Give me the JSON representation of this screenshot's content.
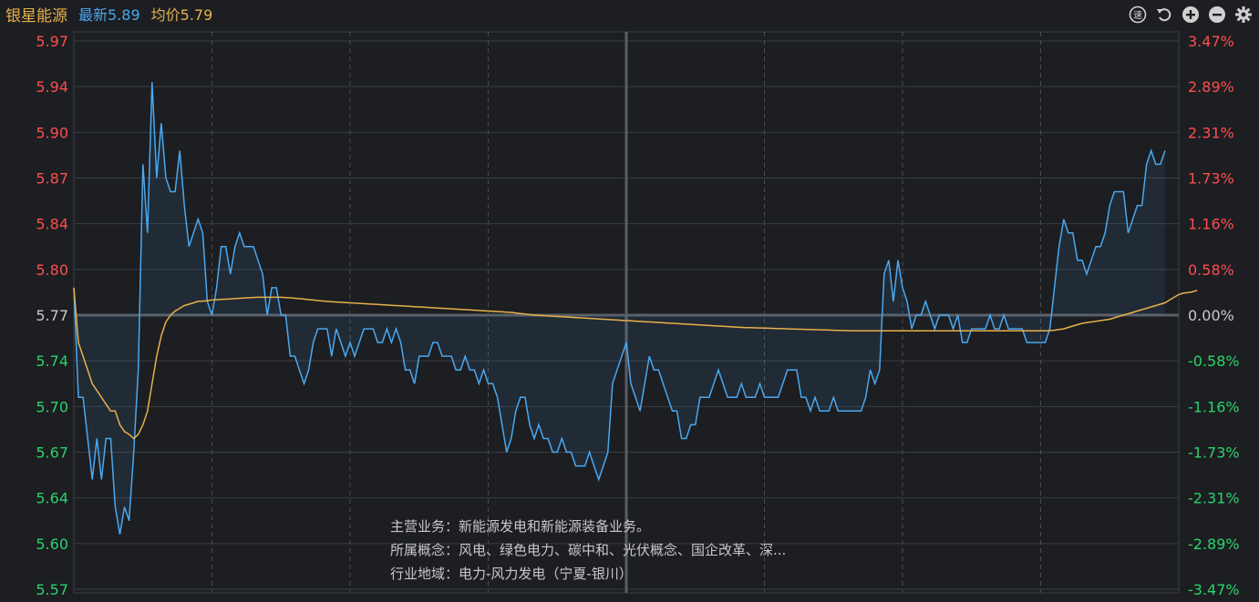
{
  "header": {
    "stock_name": "银星能源",
    "latest_label": "最新5.89",
    "avg_label": "均价5.79"
  },
  "toolbar": {
    "icons": [
      "speed-icon",
      "undo-icon",
      "zoom-in-icon",
      "zoom-out-icon",
      "settings-icon"
    ]
  },
  "info": {
    "business": "主营业务：新能源发电和新能源装备业务。",
    "concepts": "所属概念：风电、绿色电力、碳中和、光伏概念、国企改革、深...",
    "industry": "行业地域：电力-风力发电（宁夏-银川）"
  },
  "colors": {
    "price_line": "#4aa8f0",
    "avg_line": "#e8b04a",
    "up": "#ff4d4d",
    "down": "#2bd36a",
    "flat": "#c8c8c8",
    "grid": "#3a3d44",
    "background": "#1c1e22"
  },
  "chart_data": {
    "type": "line",
    "prev_close": 5.77,
    "ylim": [
      5.57,
      5.97
    ],
    "y_ticks_left": [
      "5.97",
      "5.94",
      "5.90",
      "5.87",
      "5.84",
      "5.80",
      "5.77",
      "5.74",
      "5.70",
      "5.67",
      "5.64",
      "5.60",
      "5.57"
    ],
    "y_ticks_right": [
      "3.47%",
      "2.89%",
      "2.31%",
      "1.73%",
      "1.16%",
      "0.58%",
      "0.00%",
      "-0.58%",
      "-1.16%",
      "-1.73%",
      "-2.31%",
      "-2.89%",
      "-3.47%"
    ],
    "total_minutes": 241,
    "series": [
      {
        "name": "最新",
        "values": [
          5.79,
          5.71,
          5.71,
          5.68,
          5.65,
          5.68,
          5.65,
          5.68,
          5.68,
          5.63,
          5.61,
          5.63,
          5.62,
          5.67,
          5.73,
          5.88,
          5.83,
          5.94,
          5.87,
          5.91,
          5.87,
          5.86,
          5.86,
          5.89,
          5.85,
          5.82,
          5.83,
          5.84,
          5.83,
          5.78,
          5.77,
          5.79,
          5.82,
          5.82,
          5.8,
          5.82,
          5.83,
          5.82,
          5.82,
          5.82,
          5.81,
          5.8,
          5.77,
          5.79,
          5.79,
          5.77,
          5.77,
          5.74,
          5.74,
          5.73,
          5.72,
          5.73,
          5.75,
          5.76,
          5.76,
          5.76,
          5.74,
          5.76,
          5.75,
          5.74,
          5.75,
          5.74,
          5.75,
          5.76,
          5.76,
          5.76,
          5.75,
          5.75,
          5.76,
          5.75,
          5.76,
          5.75,
          5.73,
          5.73,
          5.72,
          5.74,
          5.74,
          5.74,
          5.75,
          5.75,
          5.74,
          5.74,
          5.74,
          5.73,
          5.73,
          5.74,
          5.73,
          5.73,
          5.72,
          5.73,
          5.72,
          5.72,
          5.71,
          5.69,
          5.67,
          5.68,
          5.7,
          5.71,
          5.71,
          5.69,
          5.68,
          5.69,
          5.68,
          5.68,
          5.67,
          5.67,
          5.68,
          5.67,
          5.67,
          5.66,
          5.66,
          5.66,
          5.67,
          5.66,
          5.65,
          5.66,
          5.67,
          5.72,
          5.73,
          5.74,
          5.75,
          5.72,
          5.71,
          5.7,
          5.72,
          5.74,
          5.73,
          5.73,
          5.72,
          5.71,
          5.7,
          5.7,
          5.68,
          5.68,
          5.69,
          5.69,
          5.71,
          5.71,
          5.71,
          5.72,
          5.73,
          5.72,
          5.71,
          5.71,
          5.71,
          5.72,
          5.71,
          5.71,
          5.71,
          5.72,
          5.71,
          5.71,
          5.71,
          5.71,
          5.72,
          5.73,
          5.73,
          5.73,
          5.71,
          5.71,
          5.7,
          5.71,
          5.7,
          5.7,
          5.7,
          5.71,
          5.7,
          5.7,
          5.7,
          5.7,
          5.7,
          5.7,
          5.71,
          5.73,
          5.72,
          5.73,
          5.8,
          5.81,
          5.78,
          5.81,
          5.79,
          5.78,
          5.76,
          5.77,
          5.77,
          5.78,
          5.77,
          5.76,
          5.77,
          5.77,
          5.77,
          5.76,
          5.77,
          5.75,
          5.75,
          5.76,
          5.76,
          5.76,
          5.76,
          5.77,
          5.76,
          5.76,
          5.77,
          5.76,
          5.76,
          5.76,
          5.76,
          5.75,
          5.75,
          5.75,
          5.75,
          5.75,
          5.76,
          5.79,
          5.82,
          5.84,
          5.83,
          5.83,
          5.81,
          5.81,
          5.8,
          5.81,
          5.82,
          5.82,
          5.83,
          5.85,
          5.86,
          5.86,
          5.86,
          5.83,
          5.84,
          5.85,
          5.85,
          5.88,
          5.89,
          5.88,
          5.88,
          5.89
        ]
      },
      {
        "name": "均价",
        "values": [
          5.79,
          5.75,
          5.74,
          5.73,
          5.72,
          5.715,
          5.71,
          5.705,
          5.7,
          5.7,
          5.69,
          5.685,
          5.683,
          5.68,
          5.683,
          5.69,
          5.7,
          5.72,
          5.74,
          5.755,
          5.765,
          5.77,
          5.773,
          5.775,
          5.777,
          5.778,
          5.779,
          5.78,
          5.7802,
          5.7805,
          5.781,
          5.7812,
          5.7814,
          5.7816,
          5.7818,
          5.782,
          5.7823,
          5.7825,
          5.7827,
          5.7829,
          5.783,
          5.783,
          5.783,
          5.783,
          5.783,
          5.783,
          5.7828,
          5.7826,
          5.7823,
          5.782,
          5.7817,
          5.7813,
          5.781,
          5.7806,
          5.7803,
          5.78,
          5.7798,
          5.7796,
          5.7794,
          5.7792,
          5.779,
          5.7788,
          5.7786,
          5.7784,
          5.7782,
          5.778,
          5.7778,
          5.7776,
          5.7774,
          5.7772,
          5.777,
          5.7768,
          5.7766,
          5.7764,
          5.7762,
          5.776,
          5.7758,
          5.7756,
          5.7754,
          5.7752,
          5.775,
          5.7748,
          5.7746,
          5.7744,
          5.7742,
          5.774,
          5.7738,
          5.7736,
          5.7734,
          5.7732,
          5.773,
          5.7728,
          5.7726,
          5.7724,
          5.7722,
          5.772,
          5.7716,
          5.7712,
          5.7708,
          5.7704,
          5.77,
          5.7698,
          5.7696,
          5.7694,
          5.7692,
          5.769,
          5.7688,
          5.7686,
          5.7684,
          5.7682,
          5.768,
          5.7678,
          5.7676,
          5.7674,
          5.7672,
          5.767,
          5.7668,
          5.7666,
          5.7664,
          5.7662,
          5.766,
          5.7658,
          5.7656,
          5.7654,
          5.7652,
          5.765,
          5.7648,
          5.7646,
          5.7644,
          5.7642,
          5.764,
          5.7638,
          5.7636,
          5.7634,
          5.7632,
          5.763,
          5.7628,
          5.7626,
          5.7624,
          5.7622,
          5.762,
          5.7618,
          5.7616,
          5.7614,
          5.7612,
          5.761,
          5.7609,
          5.7608,
          5.7607,
          5.7606,
          5.7605,
          5.7604,
          5.7603,
          5.7602,
          5.7601,
          5.76,
          5.7599,
          5.7598,
          5.7597,
          5.7596,
          5.7595,
          5.7594,
          5.7593,
          5.7592,
          5.7591,
          5.759,
          5.7589,
          5.7588,
          5.7587,
          5.7586,
          5.7585,
          5.7585,
          5.7585,
          5.7585,
          5.7585,
          5.7585,
          5.7585,
          5.7585,
          5.7585,
          5.7585,
          5.7585,
          5.7585,
          5.7585,
          5.7585,
          5.7585,
          5.7585,
          5.7585,
          5.7585,
          5.7585,
          5.7585,
          5.7585,
          5.7585,
          5.7585,
          5.7585,
          5.7585,
          5.7585,
          5.7585,
          5.7585,
          5.7585,
          5.7585,
          5.7585,
          5.7585,
          5.7585,
          5.7585,
          5.7585,
          5.7585,
          5.7585,
          5.7585,
          5.7585,
          5.7585,
          5.7585,
          5.7585,
          5.7587,
          5.759,
          5.7595,
          5.76,
          5.761,
          5.762,
          5.763,
          5.764,
          5.7645,
          5.765,
          5.7655,
          5.766,
          5.7665,
          5.767,
          5.768,
          5.769,
          5.77,
          5.771,
          5.772,
          5.773,
          5.774,
          5.775,
          5.776,
          5.777,
          5.778,
          5.779,
          5.781,
          5.783,
          5.785,
          5.786,
          5.7865,
          5.787,
          5.788
        ]
      }
    ],
    "grid": true,
    "vertical_dividers": 7
  }
}
